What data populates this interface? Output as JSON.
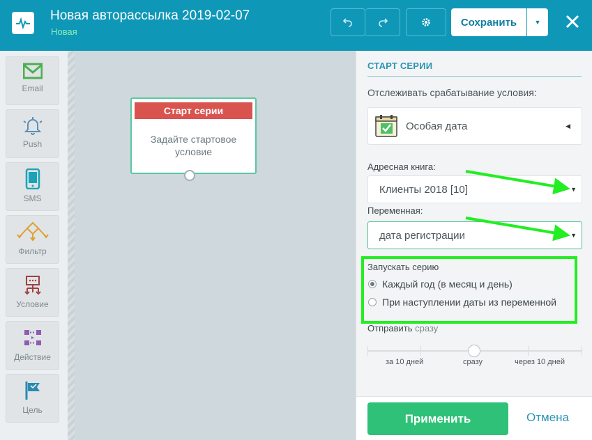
{
  "header": {
    "title": "Новая авторассылка 2019-02-07",
    "status": "Новая",
    "save_label": "Сохранить"
  },
  "sidebar": {
    "items": [
      {
        "label": "Email",
        "icon": "envelope-icon",
        "color": "#4caf50"
      },
      {
        "label": "Push",
        "icon": "bell-icon",
        "color": "#5b8fb9"
      },
      {
        "label": "SMS",
        "icon": "phone-icon",
        "color": "#1aa3b8"
      },
      {
        "label": "Фильтр",
        "icon": "filter-icon",
        "color": "#e0a030"
      },
      {
        "label": "Условие",
        "icon": "condition-icon",
        "color": "#a04040"
      },
      {
        "label": "Действие",
        "icon": "action-icon",
        "color": "#8e5bb5"
      },
      {
        "label": "Цель",
        "icon": "flag-icon",
        "color": "#2a8ab0"
      }
    ]
  },
  "canvas": {
    "node": {
      "title": "Старт серии",
      "body": "Задайте стартовое условие"
    }
  },
  "panel": {
    "title": "СТАРТ СЕРИИ",
    "track_label": "Отслеживать срабатывание условия:",
    "condition": {
      "label": "Особая дата",
      "icon": "calendar-check-icon"
    },
    "address_book": {
      "label": "Адресная книга:",
      "value": "Клиенты 2018 [10]"
    },
    "variable": {
      "label": "Переменная:",
      "value": "дата регистрации"
    },
    "launch": {
      "label": "Запускать серию",
      "options": [
        {
          "label": "Каждый год (в месяц и день)",
          "selected": true
        },
        {
          "label": "При наступлении даты из переменной",
          "selected": false
        }
      ]
    },
    "send": {
      "label_prefix": "Отправить",
      "label_value": "сразу",
      "slider_value": 0,
      "slider_labels": {
        "left": "за 10 дней",
        "center": "сразу",
        "right": "через 10 дней"
      }
    },
    "apply_label": "Применить",
    "cancel_label": "Отмена"
  },
  "colors": {
    "header": "#0f97b8",
    "accent": "#2b95b5",
    "apply": "#2ec177",
    "node_head": "#d9534f",
    "annotation": "#22ee22"
  }
}
